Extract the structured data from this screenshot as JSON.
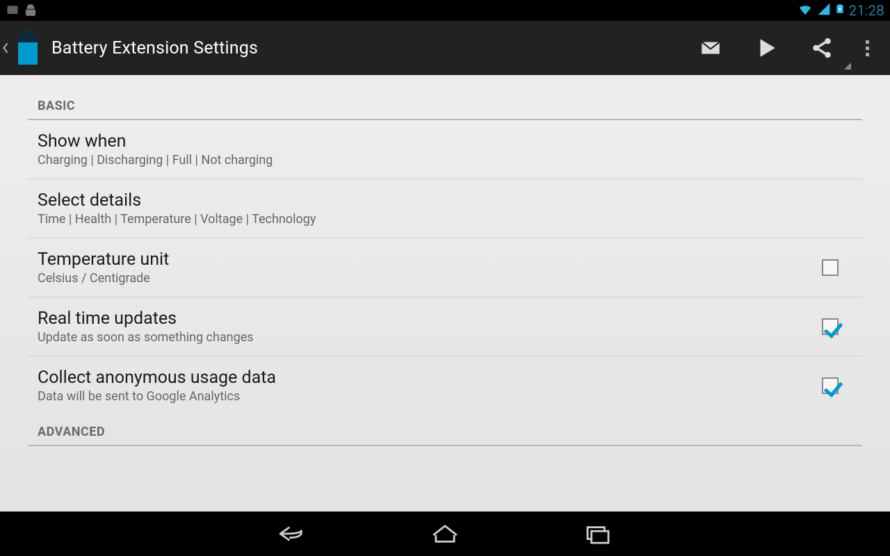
{
  "status": {
    "time": "21:28"
  },
  "header": {
    "title": "Battery Extension Settings"
  },
  "sections": {
    "basic": {
      "label": "BASIC",
      "items": [
        {
          "title": "Show when",
          "summary": "Charging | Discharging | Full | Not charging"
        },
        {
          "title": "Select details",
          "summary": "Time | Health | Temperature | Voltage | Technology"
        },
        {
          "title": "Temperature unit",
          "summary": "Celsius / Centigrade"
        },
        {
          "title": "Real time updates",
          "summary": "Update as soon as something changes"
        },
        {
          "title": "Collect anonymous usage data",
          "summary": "Data will be sent to Google Analytics"
        }
      ]
    },
    "advanced": {
      "label": "ADVANCED"
    }
  }
}
